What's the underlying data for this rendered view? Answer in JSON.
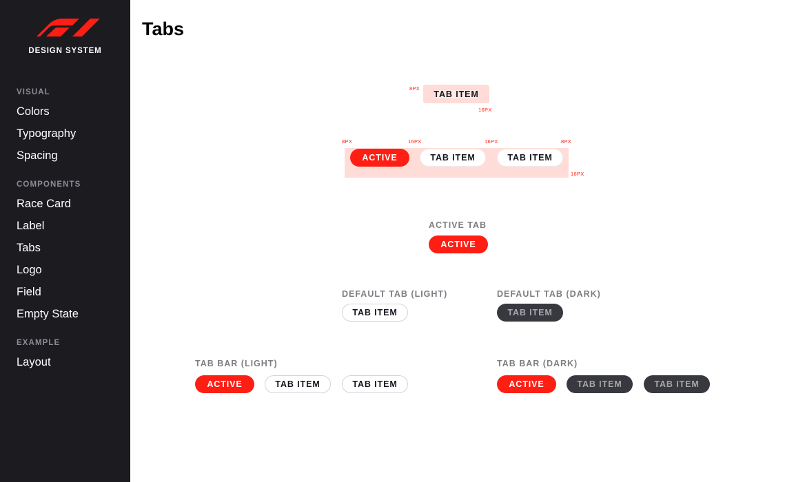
{
  "brand": {
    "name": "DESIGN SYSTEM"
  },
  "sidebar": {
    "sections": [
      {
        "title": "VISUAL",
        "items": [
          "Colors",
          "Typography",
          "Spacing"
        ]
      },
      {
        "title": "COMPONENTS",
        "items": [
          "Race Card",
          "Label",
          "Tabs",
          "Logo",
          "Field",
          "Empty State"
        ]
      },
      {
        "title": "EXAMPLE",
        "items": [
          "Layout"
        ]
      }
    ]
  },
  "page": {
    "title": "Tabs"
  },
  "spec": {
    "single_tab": {
      "label": "TAB ITEM",
      "padding_y": "8PX",
      "padding_x": "16PX"
    },
    "bar": {
      "active": "ACTIVE",
      "item1": "TAB ITEM",
      "item2": "TAB ITEM",
      "pad_left": "8PX",
      "gap1": "16PX",
      "gap2": "16PX",
      "pad_right": "8PX",
      "pad_bottom": "16PX"
    }
  },
  "examples": {
    "active_tab": {
      "label": "ACTIVE TAB",
      "tab": "ACTIVE"
    },
    "default_light": {
      "label": "DEFAULT TAB (LIGHT)",
      "tab": "TAB ITEM"
    },
    "default_dark": {
      "label": "DEFAULT TAB (DARK)",
      "tab": "TAB ITEM"
    },
    "bar_light": {
      "label": "TAB BAR (LIGHT)",
      "tabs": [
        "ACTIVE",
        "TAB ITEM",
        "TAB ITEM"
      ]
    },
    "bar_dark": {
      "label": "TAB BAR (DARK)",
      "tabs": [
        "ACTIVE",
        "TAB ITEM",
        "TAB ITEM"
      ]
    }
  },
  "colors": {
    "accent": "#ff1e14",
    "sidebar_bg": "#1c1b20",
    "dark_tab": "#38383f"
  }
}
